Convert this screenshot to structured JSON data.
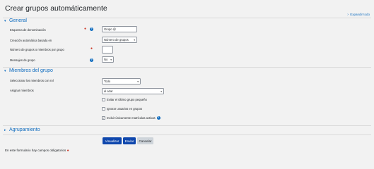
{
  "page": {
    "title": "Crear grupos automáticamente",
    "expand_all": "Expandir todo"
  },
  "general": {
    "heading": "General",
    "naming_label": "Esquema de denominación",
    "naming_value": "Grupo @",
    "auto_create_label": "Creación automática basada en",
    "auto_create_value": "Número de grupos",
    "count_label": "Número de grupos o miembros por grupo",
    "count_value": "",
    "messaging_label": "Mensajes de grupo",
    "messaging_value": "No"
  },
  "members": {
    "heading": "Miembros del grupo",
    "select_label": "Seleccionar los miembros con rol",
    "select_value": "Todo",
    "allocate_label": "Asignar miembros",
    "allocate_value": "al azar",
    "cb_small_last": "Evitar el último grupo pequeño",
    "cb_ignore_in_groups": "Ignorar usuarios en grupos",
    "cb_active_only": "Incluir únicamente matrículas activas",
    "cb_active_checked": "✓"
  },
  "grouping": {
    "heading": "Agrupamiento"
  },
  "buttons": {
    "preview": "Visualizar",
    "submit": "Enviar",
    "cancel": "Cancelar"
  },
  "footer": {
    "required_note": "En este formulario hay campos obligatorios"
  },
  "colors": {
    "link": "#0f6cbf",
    "primary": "#0f47ad",
    "required": "#ca3120"
  }
}
